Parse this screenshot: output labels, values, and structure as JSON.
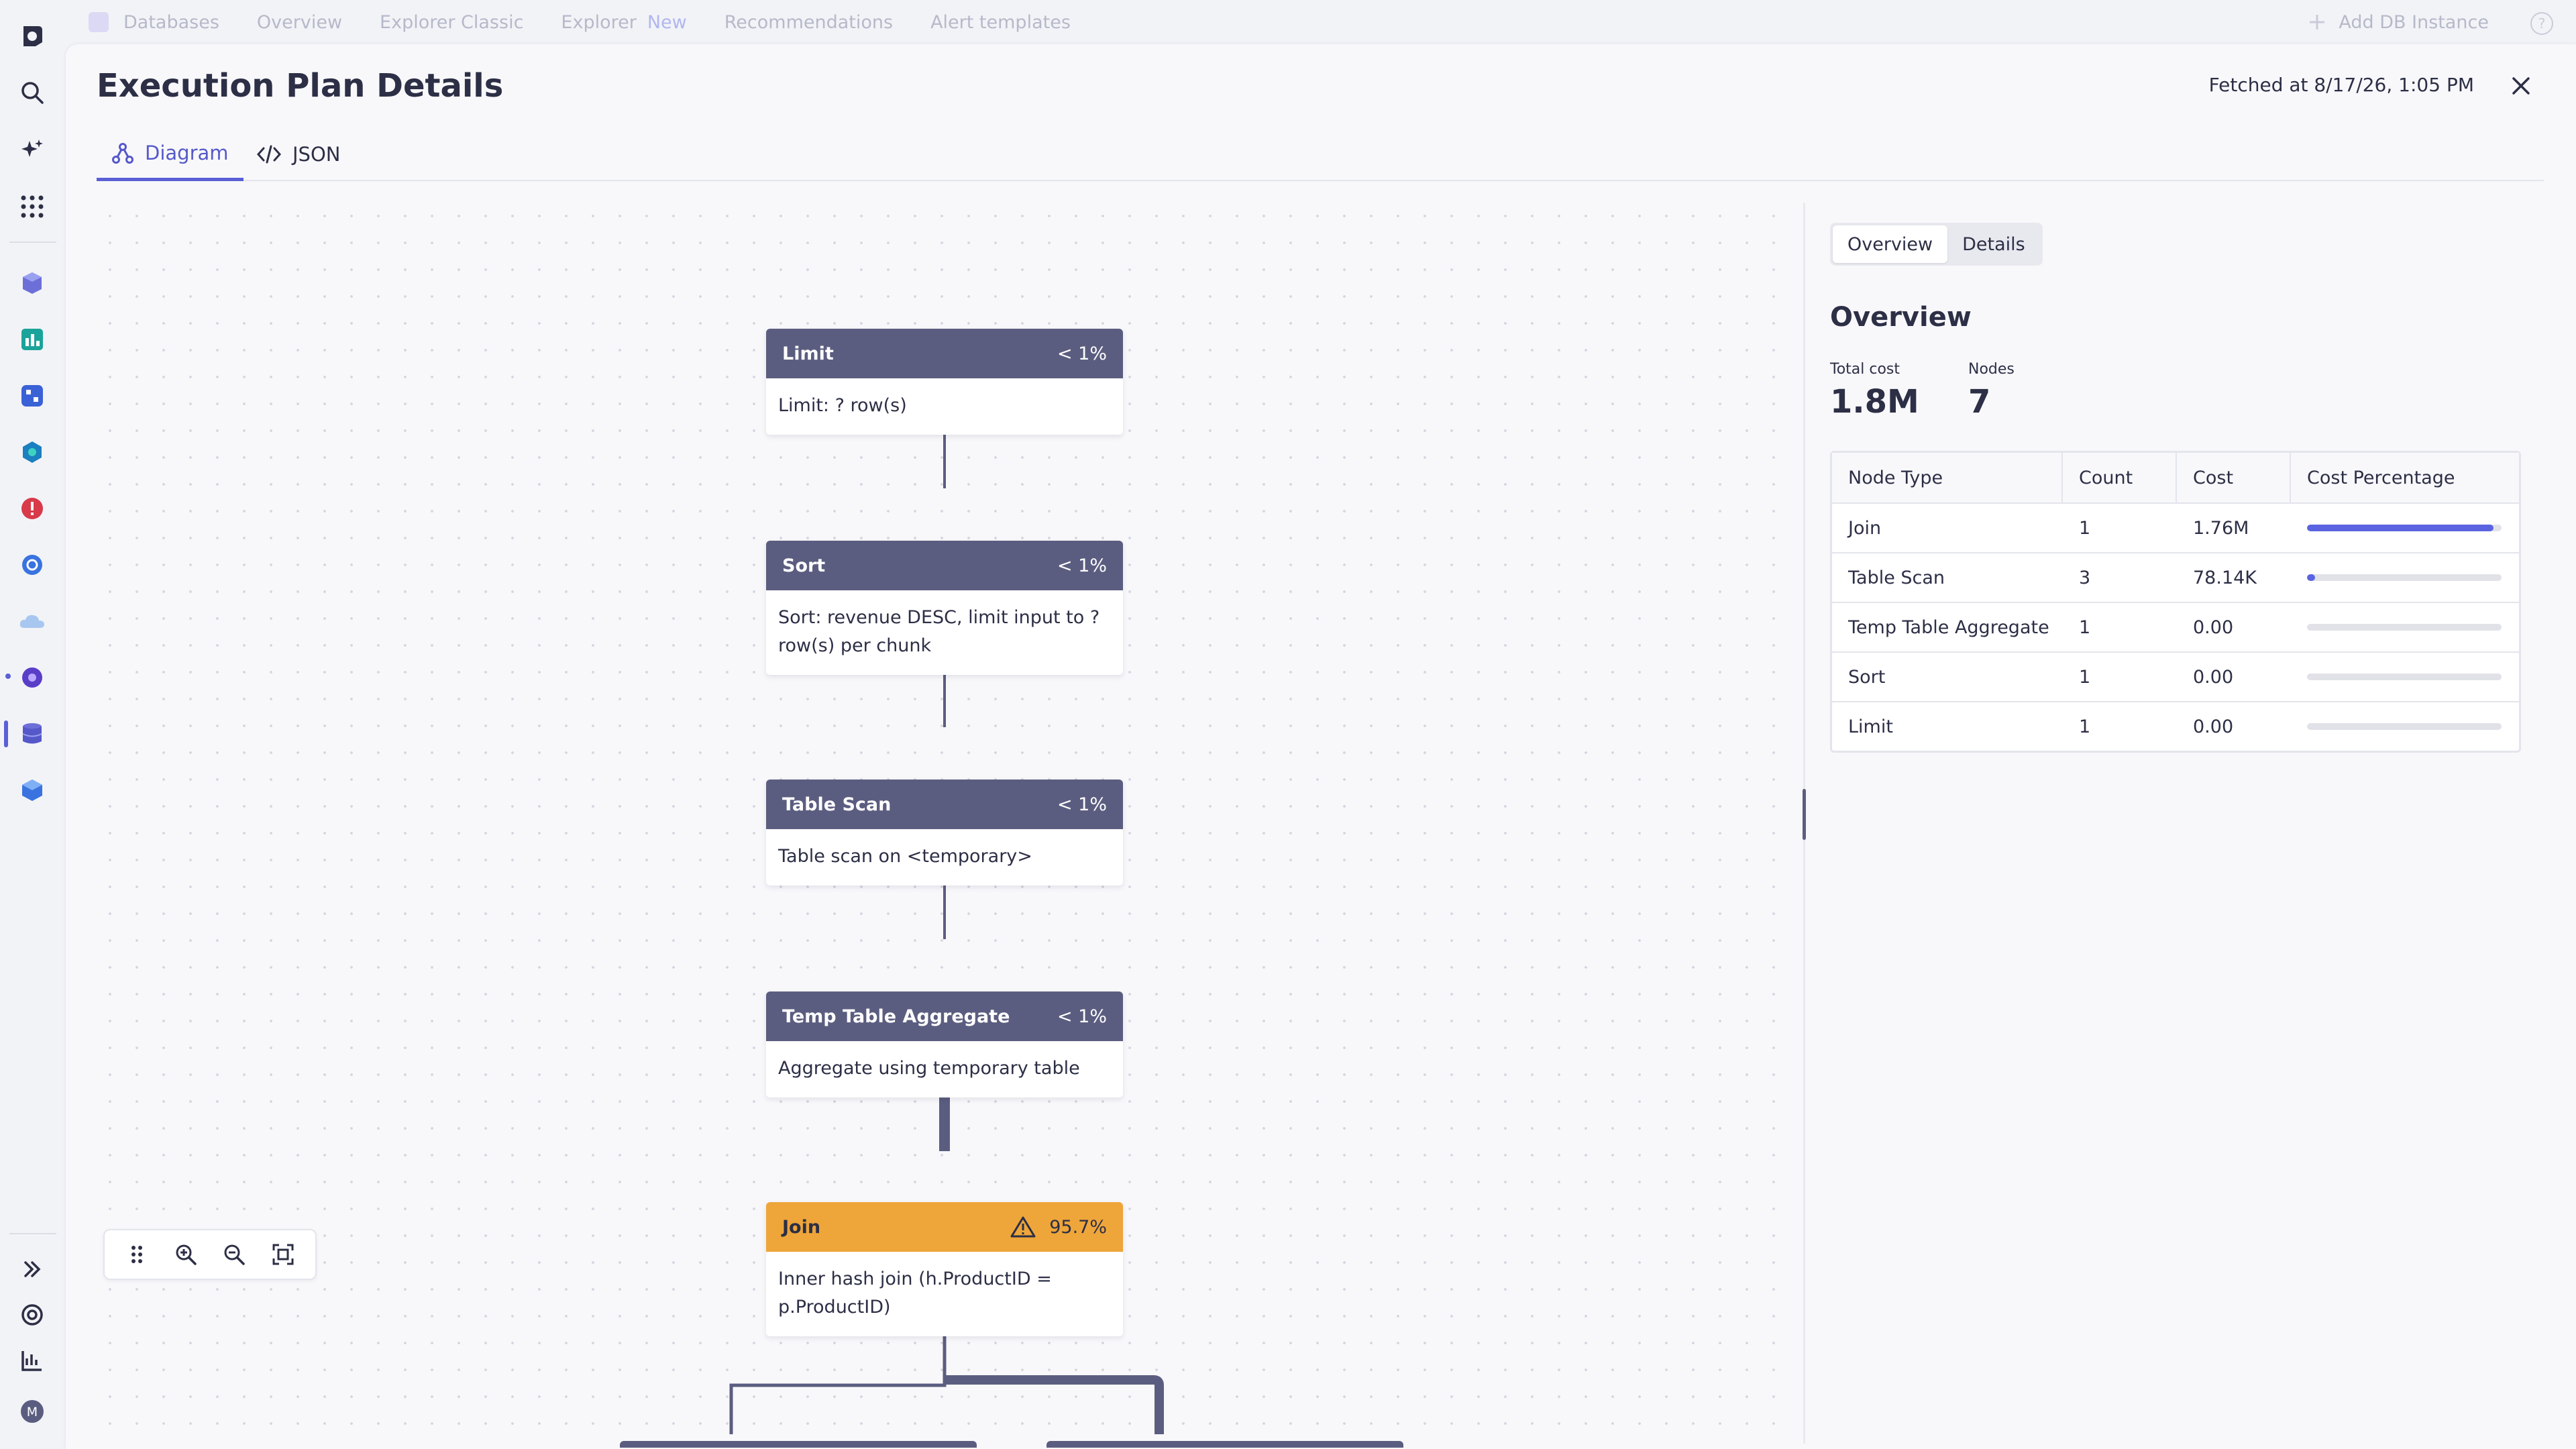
{
  "topnav": {
    "items": [
      "Databases",
      "Overview",
      "Explorer Classic",
      "Explorer",
      "Recommendations",
      "Alert templates"
    ],
    "new_badge": "New",
    "add_db": "Add DB Instance"
  },
  "page": {
    "title": "Execution Plan Details",
    "fetched": "Fetched at 8/17/26, 1:05 PM"
  },
  "tabs": {
    "diagram": "Diagram",
    "json": "JSON"
  },
  "nodes": [
    {
      "title": "Limit",
      "pct": "< 1%",
      "body": "Limit: ? row(s)",
      "warn": false
    },
    {
      "title": "Sort",
      "pct": "< 1%",
      "body": "Sort: revenue DESC, limit input to ? row(s) per chunk",
      "warn": false
    },
    {
      "title": "Table Scan",
      "pct": "< 1%",
      "body": "Table scan on <temporary>",
      "warn": false
    },
    {
      "title": "Temp Table Aggregate",
      "pct": "< 1%",
      "body": "Aggregate using temporary table",
      "warn": false
    },
    {
      "title": "Join",
      "pct": "95.7%",
      "body": "Inner hash join (h.ProductID = p.ProductID)",
      "warn": true
    }
  ],
  "side": {
    "seg": [
      "Overview",
      "Details"
    ],
    "title": "Overview",
    "total_cost_label": "Total cost",
    "total_cost": "1.8M",
    "nodes_label": "Nodes",
    "nodes_value": "7",
    "table": {
      "headers": [
        "Node Type",
        "Count",
        "Cost",
        "Cost Percentage"
      ],
      "rows": [
        {
          "type": "Join",
          "count": "1",
          "cost": "1.76M",
          "pct": 0.957
        },
        {
          "type": "Table Scan",
          "count": "3",
          "cost": "78.14K",
          "pct": 0.043
        },
        {
          "type": "Temp Table Aggregate",
          "count": "1",
          "cost": "0.00",
          "pct": 0
        },
        {
          "type": "Sort",
          "count": "1",
          "cost": "0.00",
          "pct": 0
        },
        {
          "type": "Limit",
          "count": "1",
          "cost": "0.00",
          "pct": 0
        }
      ]
    }
  },
  "colors": {
    "accent": "#5a5fd6",
    "node_header": "#5b5d80",
    "warn": "#eea53a",
    "bar": "#5a63e0"
  }
}
